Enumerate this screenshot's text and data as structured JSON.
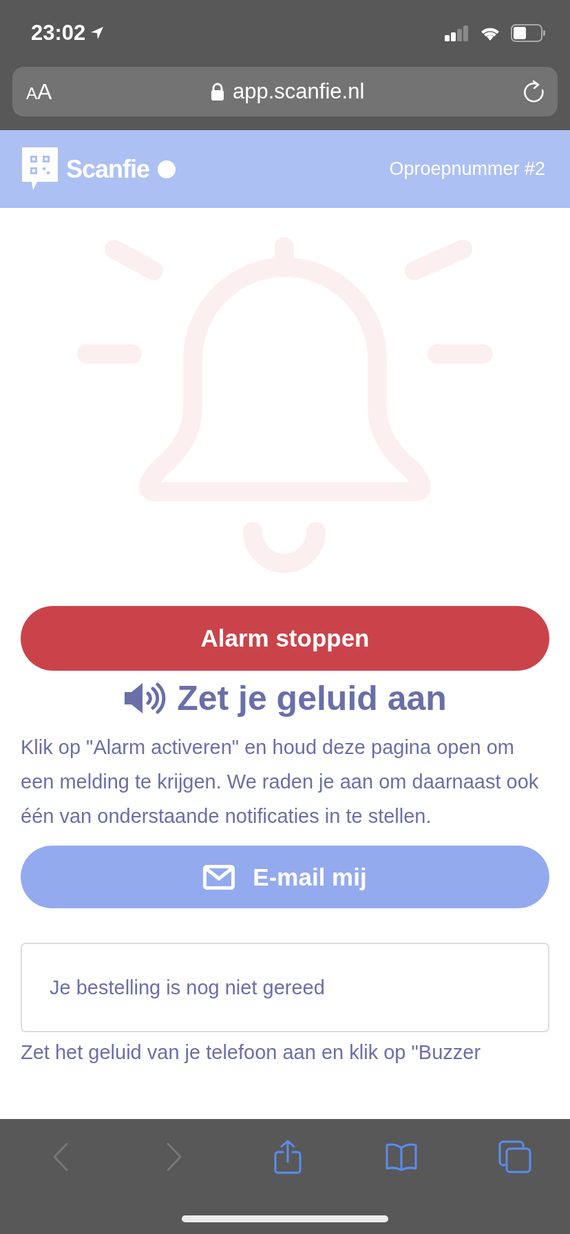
{
  "status_bar": {
    "time": "23:02"
  },
  "browser": {
    "text_size_label": "AA",
    "url": "app.scanfie.nl"
  },
  "header": {
    "brand": "Scanfie",
    "call_number": "Oproepnummer #2"
  },
  "alarm_button": {
    "label": "Alarm stoppen"
  },
  "sound_heading": "Zet je geluid aan",
  "intro": "Klik op \"Alarm activeren\" en houd deze pagina open om een melding te krijgen. We raden je aan om daarnaast ook één van onderstaande notificaties in te stellen.",
  "email_button": {
    "label": "E-mail mij"
  },
  "order_status": "Je bestelling is nog niet gereed",
  "instructions": "Zet het geluid van je telefoon aan en klik op \"Buzzer",
  "toolbar": [
    {
      "kind": "back",
      "disabled": true
    },
    {
      "kind": "forward",
      "disabled": true
    },
    {
      "kind": "share",
      "disabled": false
    },
    {
      "kind": "bookmarks",
      "disabled": false
    },
    {
      "kind": "tabs",
      "disabled": false
    }
  ]
}
